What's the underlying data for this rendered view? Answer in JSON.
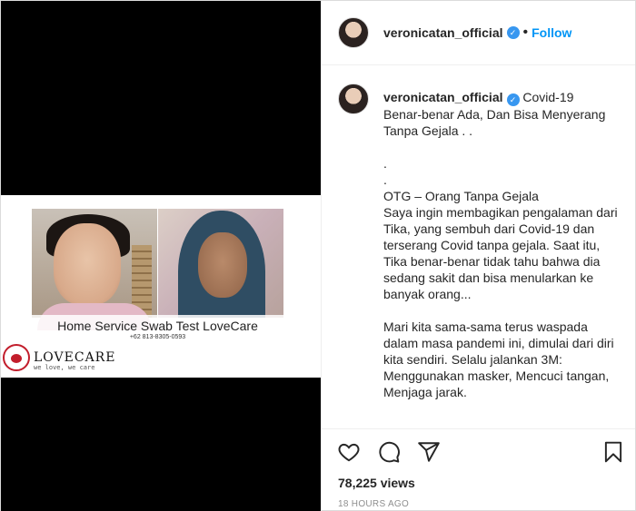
{
  "media": {
    "video_caption_title": "Home Service Swab Test LoveCare",
    "video_caption_phone": "+62 813-8305-0593",
    "logo_name": "LOVECARE",
    "logo_tagline": "we love, we care"
  },
  "header": {
    "username": "veronicatan_official",
    "separator": "•",
    "follow_label": "Follow",
    "more_label": "···"
  },
  "caption": {
    "username": "veronicatan_official",
    "text": "Covid-19\nBenar-benar Ada, Dan Bisa Menyerang Tanpa Gejala . .\n\n.\n.\nOTG – Orang Tanpa Gejala\nSaya ingin membagikan pengalaman dari Tika, yang sembuh dari Covid-19 dan terserang Covid tanpa gejala. Saat itu, Tika benar-benar tidak tahu bahwa dia sedang sakit dan bisa menularkan ke banyak orang...\n\nMari kita sama-sama terus waspada dalam masa pandemi ini, dimulai dari diri kita sendiri. Selalu jalankan 3M: Menggunakan masker, Mencuci tangan, Menjaga jarak."
  },
  "stats": {
    "views": "78,225 views",
    "timestamp": "18 HOURS AGO"
  },
  "icons": {
    "like": "heart-icon",
    "comment": "comment-icon",
    "share": "share-icon",
    "save": "bookmark-icon",
    "verified": "verified-badge-icon"
  },
  "colors": {
    "accent": "#0095f6",
    "verified": "#3897f0",
    "muted": "#8e8e8e"
  }
}
